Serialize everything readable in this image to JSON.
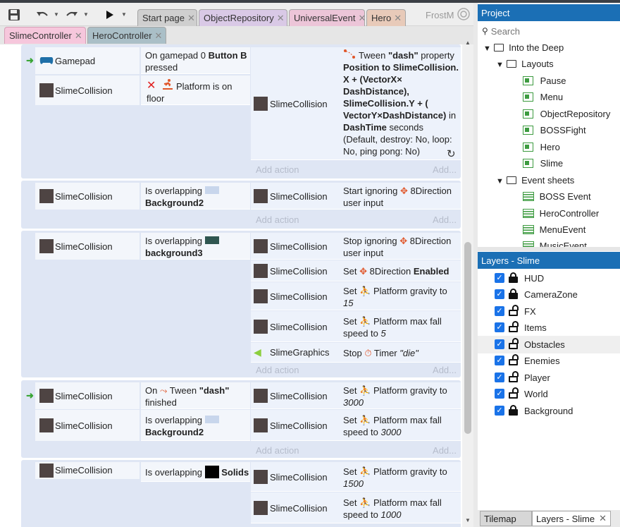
{
  "colors": {
    "accent": "#1b6fb5",
    "event_bg": "#dfe6f4",
    "green": "#3aa535"
  },
  "toolbar": {
    "save": "save-icon",
    "undo": "undo-icon",
    "redo": "redo-icon",
    "play": "play-icon",
    "app_name": "FrostM"
  },
  "tabs": [
    {
      "label": "Start page"
    },
    {
      "label": "ObjectRepository"
    },
    {
      "label": "UniversalEvent"
    },
    {
      "label": "Hero"
    }
  ],
  "subtabs": [
    {
      "label": "SlimeController"
    },
    {
      "label": "HeroController"
    }
  ],
  "close": "✕",
  "events": {
    "e1": {
      "cond1_obj": "Gamepad",
      "cond1_text": "On gamepad 0",
      "cond1_bold": "Button B",
      "cond1_text2": "pressed",
      "cond2_obj": "SlimeCollision",
      "cond2_text": "Platform is on floor",
      "act_obj": "SlimeCollision",
      "act_l1": "Tween",
      "act_l1b": "\"dash\"",
      "act_l1c": "property",
      "act_l2": "Position to SlimeCollision.",
      "act_l3": "X + (VectorX×",
      "act_l4": "DashDistance),",
      "act_l5": "SlimeCollision.Y + (",
      "act_l6a": "VectorY×DashDistance)",
      "act_l6b": "in",
      "act_l7a": "DashTime",
      "act_l7b": "seconds",
      "act_l8": "(Default, destroy: No, loop:",
      "act_l9": "No, ping pong: No)"
    },
    "e2": {
      "cond_obj": "SlimeCollision",
      "cond_text": "Is overlapping",
      "cond_bold": "Background2",
      "act_obj": "SlimeCollision",
      "act_text": "Start ignoring",
      "act_beh": "8Direction",
      "act_text2": "user input"
    },
    "e3": {
      "cond_obj": "SlimeCollision",
      "cond_text": "Is overlapping",
      "cond_bold": "background3",
      "a1_obj": "SlimeCollision",
      "a1_text": "Stop ignoring",
      "a1_beh": "8Direction",
      "a1_text2": "user input",
      "a2_obj": "SlimeCollision",
      "a2_text": "Set",
      "a2_beh": "8Direction",
      "a2_bold": "Enabled",
      "a3_obj": "SlimeCollision",
      "a3_text": "Set",
      "a3_beh": "Platform gravity to",
      "a3_val": "15",
      "a4_obj": "SlimeCollision",
      "a4_text": "Set",
      "a4_beh": "Platform max fall",
      "a4_text2": "speed to",
      "a4_val": "5",
      "a5_obj": "SlimeGraphics",
      "a5_text": "Stop",
      "a5_beh": "Timer",
      "a5_val": "\"die\""
    },
    "e4": {
      "cond1_obj": "SlimeCollision",
      "cond1_text": "On",
      "cond1_beh": "Tween",
      "cond1_bold": "\"dash\"",
      "cond1_text2": "finished",
      "cond2_obj": "SlimeCollision",
      "cond2_text": "Is overlapping",
      "cond2_bold": "Background2",
      "a1_obj": "SlimeCollision",
      "a1_text": "Set",
      "a1_beh": "Platform gravity to",
      "a1_val": "3000",
      "a2_obj": "SlimeCollision",
      "a2_text": "Set",
      "a2_beh": "Platform max fall",
      "a2_text2": "speed to",
      "a2_val": "3000"
    },
    "e5": {
      "cond_obj": "SlimeCollision",
      "cond_text": "Is overlapping",
      "cond_bold": "Solids",
      "a1_obj": "SlimeCollision",
      "a1_text": "Set",
      "a1_beh": "Platform gravity to",
      "a1_val": "1500",
      "a2_obj": "SlimeCollision",
      "a2_text": "Set",
      "a2_beh": "Platform max fall",
      "a2_text2": "speed to",
      "a2_val": "1000"
    },
    "add_action": "Add action",
    "add_more": "Add..."
  },
  "project": {
    "title": "Project",
    "search_placeholder": "Search",
    "root": "Into the Deep",
    "layouts_folder": "Layouts",
    "layouts": [
      "Pause",
      "Menu",
      "ObjectRepository",
      "BOSSFight",
      "Hero",
      "Slime"
    ],
    "sheets_folder": "Event sheets",
    "sheets": [
      "BOSS Event",
      "HeroController",
      "MenuEvent",
      "MusicEvent"
    ]
  },
  "layers": {
    "title": "Layers - Slime",
    "items": [
      {
        "name": "HUD",
        "locked": true
      },
      {
        "name": "CameraZone",
        "locked": true
      },
      {
        "name": "FX",
        "locked": false
      },
      {
        "name": "Items",
        "locked": false
      },
      {
        "name": "Obstacles",
        "locked": false
      },
      {
        "name": "Enemies",
        "locked": false
      },
      {
        "name": "Player",
        "locked": false
      },
      {
        "name": "World",
        "locked": false
      },
      {
        "name": "Background",
        "locked": true
      }
    ]
  },
  "bottom_tabs": [
    {
      "label": "Tilemap"
    },
    {
      "label": "Layers - Slime"
    }
  ]
}
